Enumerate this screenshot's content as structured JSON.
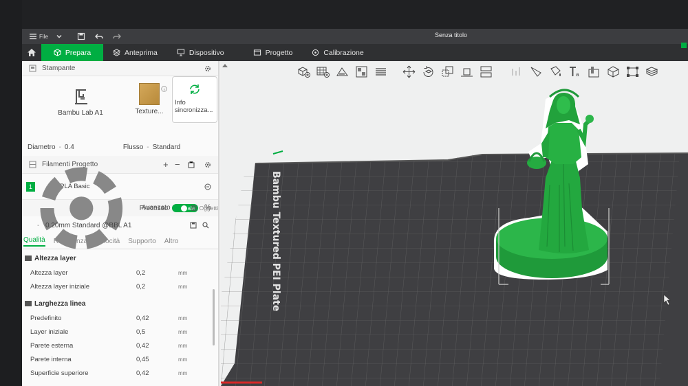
{
  "window": {
    "title": "Senza titolo"
  },
  "titlebar": {
    "file_label": "File"
  },
  "tabs": [
    {
      "label": "Prepara",
      "icon": "cube-icon",
      "active": true
    },
    {
      "label": "Anteprima",
      "icon": "layers-icon",
      "active": false
    },
    {
      "label": "Dispositivo",
      "icon": "device-icon",
      "active": false
    },
    {
      "label": "Progetto",
      "icon": "project-icon",
      "active": false
    },
    {
      "label": "Calibrazione",
      "icon": "calibration-icon",
      "active": false
    }
  ],
  "printer_section": {
    "title": "Stampante",
    "printer_name": "Bambu Lab A1",
    "plate_label": "Texture...",
    "sync_label_1": "Info",
    "sync_label_2": "sincronizza...",
    "diameter_label": "Diametro",
    "diameter_value": "0.4",
    "flow_label": "Flusso",
    "flow_value": "Standard"
  },
  "filament_section": {
    "title": "Filamenti Progetto",
    "items": [
      {
        "index": "1",
        "name": "PLA Basic",
        "color": "#00ae42"
      }
    ]
  },
  "process_section": {
    "title": "Processo",
    "badge_global": "Globale",
    "badge_objects": "Oggetti",
    "advanced_label": "Avanzato",
    "preset": "0.20mm Standard @BBL A1",
    "subtabs": [
      "Qualità",
      "Resistenza",
      "Velocità",
      "Supporto",
      "Altro"
    ],
    "groups": [
      {
        "title": "Altezza layer",
        "params": [
          {
            "label": "Altezza layer",
            "value": "0,2",
            "unit": "mm"
          },
          {
            "label": "Altezza layer iniziale",
            "value": "0,2",
            "unit": "mm"
          }
        ]
      },
      {
        "title": "Larghezza linea",
        "params": [
          {
            "label": "Predefinito",
            "value": "0,42",
            "unit": "mm"
          },
          {
            "label": "Layer iniziale",
            "value": "0,5",
            "unit": "mm"
          },
          {
            "label": "Parete esterna",
            "value": "0,42",
            "unit": "mm"
          },
          {
            "label": "Parete interna",
            "value": "0,45",
            "unit": "mm"
          },
          {
            "label": "Superficie superiore",
            "value": "0,42",
            "unit": "mm"
          }
        ]
      }
    ]
  },
  "viewport": {
    "plate_text": "Bambu Textured PEI Plate",
    "model_color": "#23a83f",
    "accent": "#00ae42"
  }
}
